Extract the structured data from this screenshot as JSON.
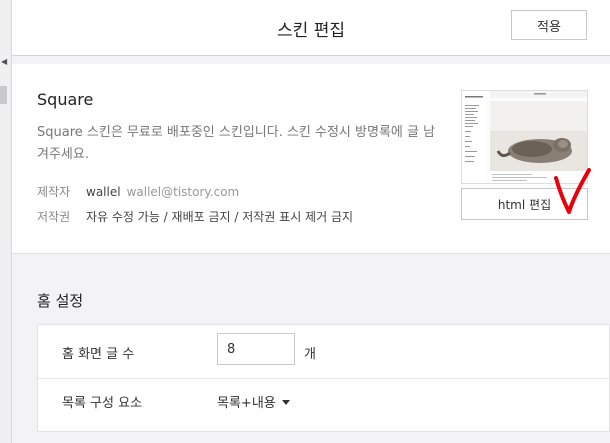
{
  "header": {
    "title": "스킨 편집",
    "apply_label": "적용"
  },
  "skin": {
    "name": "Square",
    "description": "Square 스킨은 무료로 배포중인 스킨입니다. 스킨 수정시 방명록에 글 남겨주세요.",
    "author_label": "제작자",
    "author_name": "wallel",
    "author_email": "wallel@tistory.com",
    "license_label": "저작권",
    "license_text": "자유 수정 가능 / 재배포 금지 / 저작권 표시 제거 금지",
    "html_edit_label": "html 편집"
  },
  "home_settings": {
    "title": "홈 설정",
    "post_count_label": "홈 화면 글 수",
    "post_count_value": "8",
    "post_count_unit": "개",
    "list_component_label": "목록 구성 요소",
    "list_component_value": "목록+내용"
  },
  "colors": {
    "annotation": "#e8000f",
    "border": "#c7c7cc",
    "background": "#f3f3f5"
  },
  "icons": {
    "annotation_mark": "red-checkmark-icon",
    "dropdown": "caret-down-icon"
  }
}
